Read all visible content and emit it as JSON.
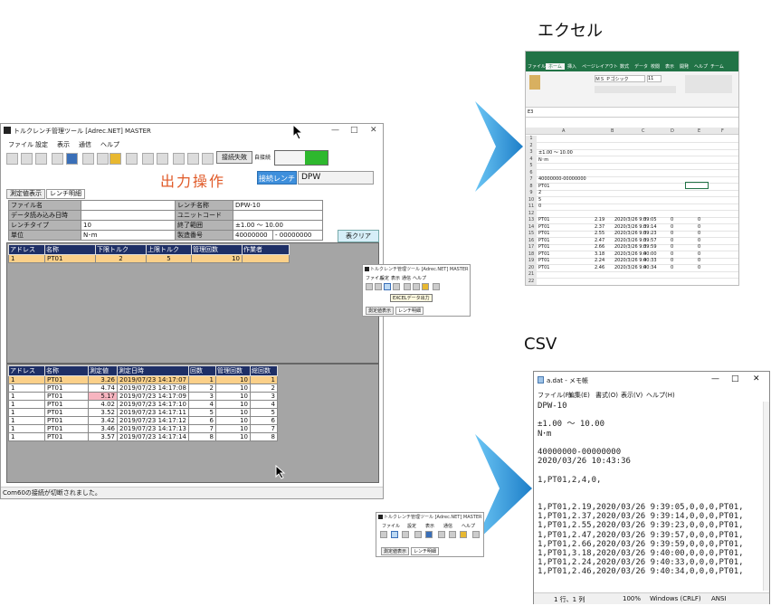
{
  "main_window": {
    "title": "トルクレンチ管理ツール [Adrec.NET] MASTER",
    "controls": [
      "—",
      "□",
      "✕"
    ],
    "menu": [
      "ファイル",
      "設定",
      "表示",
      "通信",
      "ヘルプ"
    ],
    "conn_status": "接続失敗",
    "conn_label": "自接続",
    "op_title": "出力操作",
    "wrench_btn": "接続レンチ",
    "wrench_name": "DPW",
    "tabs": [
      "測定値表示",
      "レンチ明細"
    ],
    "info": {
      "file_name_label": "ファイル名",
      "file_name": "",
      "wrench_name_label": "レンチ名称",
      "wrench_name_val": "DPW-10",
      "read_date_label": "データ読み込み日時",
      "read_date": "",
      "unit_code_label": "ユニットコード",
      "unit_code": "",
      "wrench_type_label": "レンチタイプ",
      "wrench_type": "10",
      "range_label": "終了範囲",
      "range": "±1.00 ～ 10.00",
      "unit_label": "単位",
      "unit": "N･m",
      "serial_label": "製造番号",
      "serial_from": "40000000",
      "serial_to": "- 00000000"
    },
    "clear_btn": "表クリア",
    "top_table": {
      "headers": [
        "アドレス",
        "名称",
        "下限トルク",
        "上限トルク",
        "管理回数",
        "作業者"
      ],
      "rows": [
        [
          "1",
          "PT01",
          "2",
          "5",
          "10",
          ""
        ]
      ]
    },
    "bottom_table": {
      "headers": [
        "アドレス",
        "名称",
        "測定値",
        "測定日時",
        "回数",
        "管理回数",
        "総回数"
      ],
      "rows": [
        [
          "1",
          "PT01",
          "3.26",
          "2019/07/23 14:17:07",
          "1",
          "10",
          "1"
        ],
        [
          "1",
          "PT01",
          "4.74",
          "2019/07/23 14:17:08",
          "2",
          "10",
          "2"
        ],
        [
          "1",
          "PT01",
          "5.17",
          "2019/07/23 14:17:09",
          "3",
          "10",
          "3"
        ],
        [
          "1",
          "PT01",
          "4.02",
          "2019/07/23 14:17:10",
          "4",
          "10",
          "4"
        ],
        [
          "1",
          "PT01",
          "3.52",
          "2019/07/23 14:17:11",
          "5",
          "10",
          "5"
        ],
        [
          "1",
          "PT01",
          "3.42",
          "2019/07/23 14:17:12",
          "6",
          "10",
          "6"
        ],
        [
          "1",
          "PT01",
          "3.46",
          "2019/07/23 14:17:13",
          "7",
          "10",
          "7"
        ],
        [
          "1",
          "PT01",
          "3.57",
          "2019/07/23 14:17:14",
          "8",
          "10",
          "8"
        ]
      ]
    },
    "status": "Com60の接続が切断されました。"
  },
  "mini_window_1": {
    "title": "トルクレンチ管理ツール [Adrec.NET] MASTER",
    "menu": [
      "ファイル",
      "設定",
      "表示",
      "通信",
      "ヘルプ"
    ],
    "tooltip": "EXCELデータ出力",
    "tabs": [
      "測定値表示",
      "レンチ明細"
    ]
  },
  "mini_window_2": {
    "title": "トルクレンチ管理ツール [Adrec.NET] MASTER",
    "menu": [
      "ファイル",
      "設定",
      "表示",
      "通信",
      "ヘルプ"
    ],
    "tabs": [
      "測定値表示",
      "レンチ明細"
    ]
  },
  "excel_heading": "エクセル",
  "csv_heading": "CSV",
  "excel": {
    "tabs": [
      "ファイル",
      "ホーム",
      "挿入",
      "ページレイアウト",
      "数式",
      "データ",
      "校閲",
      "表示",
      "開発",
      "ヘルプ",
      "チーム"
    ],
    "font": "ＭＳ Ｐゴシック",
    "font_size": "11",
    "cell_ref": "E3",
    "columns": [
      "A",
      "B",
      "C",
      "D",
      "E",
      "F"
    ],
    "rows": [
      [
        "1",
        "",
        "",
        "",
        "",
        "",
        ""
      ],
      [
        "2",
        "",
        "",
        "",
        "",
        "",
        ""
      ],
      [
        "3",
        "±1.00 ～ 10.00",
        "",
        "",
        "",
        "",
        ""
      ],
      [
        "4",
        "N･m",
        "",
        "",
        "",
        "",
        ""
      ],
      [
        "5",
        "",
        "",
        "",
        "",
        "",
        ""
      ],
      [
        "6",
        "",
        "",
        "",
        "",
        "",
        ""
      ],
      [
        "7",
        "40000000-00000000",
        "",
        "",
        "",
        "",
        ""
      ],
      [
        "8",
        "PT01",
        "",
        "",
        "",
        "",
        ""
      ],
      [
        "9",
        "2",
        "",
        "",
        "",
        "",
        ""
      ],
      [
        "10",
        "5",
        "",
        "",
        "",
        "",
        ""
      ],
      [
        "11",
        "0",
        "",
        "",
        "",
        "",
        ""
      ],
      [
        "12",
        "",
        "",
        "",
        "",
        "",
        ""
      ],
      [
        "13",
        "PT01",
        "2.19",
        "2020/3/26 9:39:05",
        "0",
        "0",
        "0"
      ],
      [
        "14",
        "PT01",
        "2.37",
        "2020/3/26 9:39:14",
        "0",
        "0",
        "0"
      ],
      [
        "15",
        "PT01",
        "2.55",
        "2020/3/26 9:39:23",
        "0",
        "0",
        "0"
      ],
      [
        "16",
        "PT01",
        "2.47",
        "2020/3/26 9:39:57",
        "0",
        "0",
        "0"
      ],
      [
        "17",
        "PT01",
        "2.66",
        "2020/3/26 9:39:59",
        "0",
        "0",
        "0"
      ],
      [
        "18",
        "PT01",
        "3.18",
        "2020/3/26 9:40:00",
        "0",
        "0",
        "0"
      ],
      [
        "19",
        "PT01",
        "2.24",
        "2020/3/26 9:40:33",
        "0",
        "0",
        "0"
      ],
      [
        "20",
        "PT01",
        "2.46",
        "2020/3/26 9:40:34",
        "0",
        "0",
        "0"
      ],
      [
        "21",
        "",
        "",
        "",
        "",
        "",
        ""
      ],
      [
        "22",
        "",
        "",
        "",
        "",
        "",
        ""
      ]
    ]
  },
  "notepad": {
    "title": "a.dat - メモ帳",
    "controls": [
      "—",
      "□",
      "✕"
    ],
    "menu": [
      "ファイル(F)",
      "編集(E)",
      "書式(O)",
      "表示(V)",
      "ヘルプ(H)"
    ],
    "lines": [
      "DPW-10",
      "",
      "±1.00 ～ 10.00",
      "N･m",
      "",
      "40000000-00000000",
      "2020/03/26 10:43:36",
      "",
      "1,PT01,2,4,0,",
      "",
      "",
      "1,PT01,2.19,2020/03/26 9:39:05,0,0,0,PT01,",
      "1,PT01,2.37,2020/03/26 9:39:14,0,0,0,PT01,",
      "1,PT01,2.55,2020/03/26 9:39:23,0,0,0,PT01,",
      "1,PT01,2.47,2020/03/26 9:39:57,0,0,0,PT01,",
      "1,PT01,2.66,2020/03/26 9:39:59,0,0,0,PT01,",
      "1,PT01,3.18,2020/03/26 9:40:00,0,0,0,PT01,",
      "1,PT01,2.24,2020/03/26 9:40:33,0,0,0,PT01,",
      "1,PT01,2.46,2020/03/26 9:40:34,0,0,0,PT01,"
    ],
    "status": [
      "1 行、1 列",
      "100%",
      "Windows (CRLF)",
      "ANSI"
    ]
  },
  "colors": {
    "accent_blue": "#3e8fdc",
    "title_orange": "#e05a28",
    "header_navy": "#1e2f66",
    "excel_green": "#217346",
    "selected_row": "#fbd089",
    "arrow_blue": "#2f9be0"
  }
}
